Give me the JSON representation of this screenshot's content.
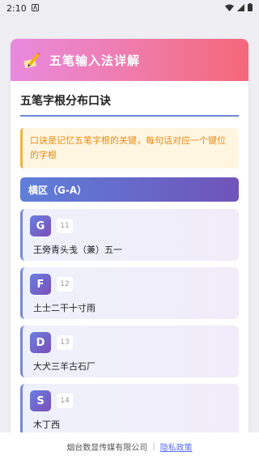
{
  "status_bar": {
    "time": "2:10",
    "icons": [
      "notification-a-icon",
      "wifi-icon",
      "signal-icon",
      "battery-icon"
    ]
  },
  "hero": {
    "title": "五笔输入法详解",
    "icon": "pen-paper-icon"
  },
  "section": {
    "title": "五笔字根分布口诀"
  },
  "tip": {
    "text": "口诀是记忆五笔字根的关键，每句话对应一个键位的字根"
  },
  "zone": {
    "title": "横区（G-A）"
  },
  "keys": [
    {
      "letter": "G",
      "code": "11",
      "roots": "王旁青头戋（兼）五一"
    },
    {
      "letter": "F",
      "code": "12",
      "roots": "土士二干十寸雨"
    },
    {
      "letter": "D",
      "code": "13",
      "roots": "大犬三羊古石厂"
    },
    {
      "letter": "S",
      "code": "14",
      "roots": "木丁西"
    }
  ],
  "footer": {
    "company": "烟台数显传媒有限公司",
    "separator": "|",
    "privacy_link": "隐私政策"
  },
  "colors": {
    "accent_blue": "#6f86d6",
    "accent_purple": "#7054b9",
    "hero_pink": "#f07aa6",
    "tip_orange": "#ea8a17",
    "link": "#5b6ef5"
  }
}
